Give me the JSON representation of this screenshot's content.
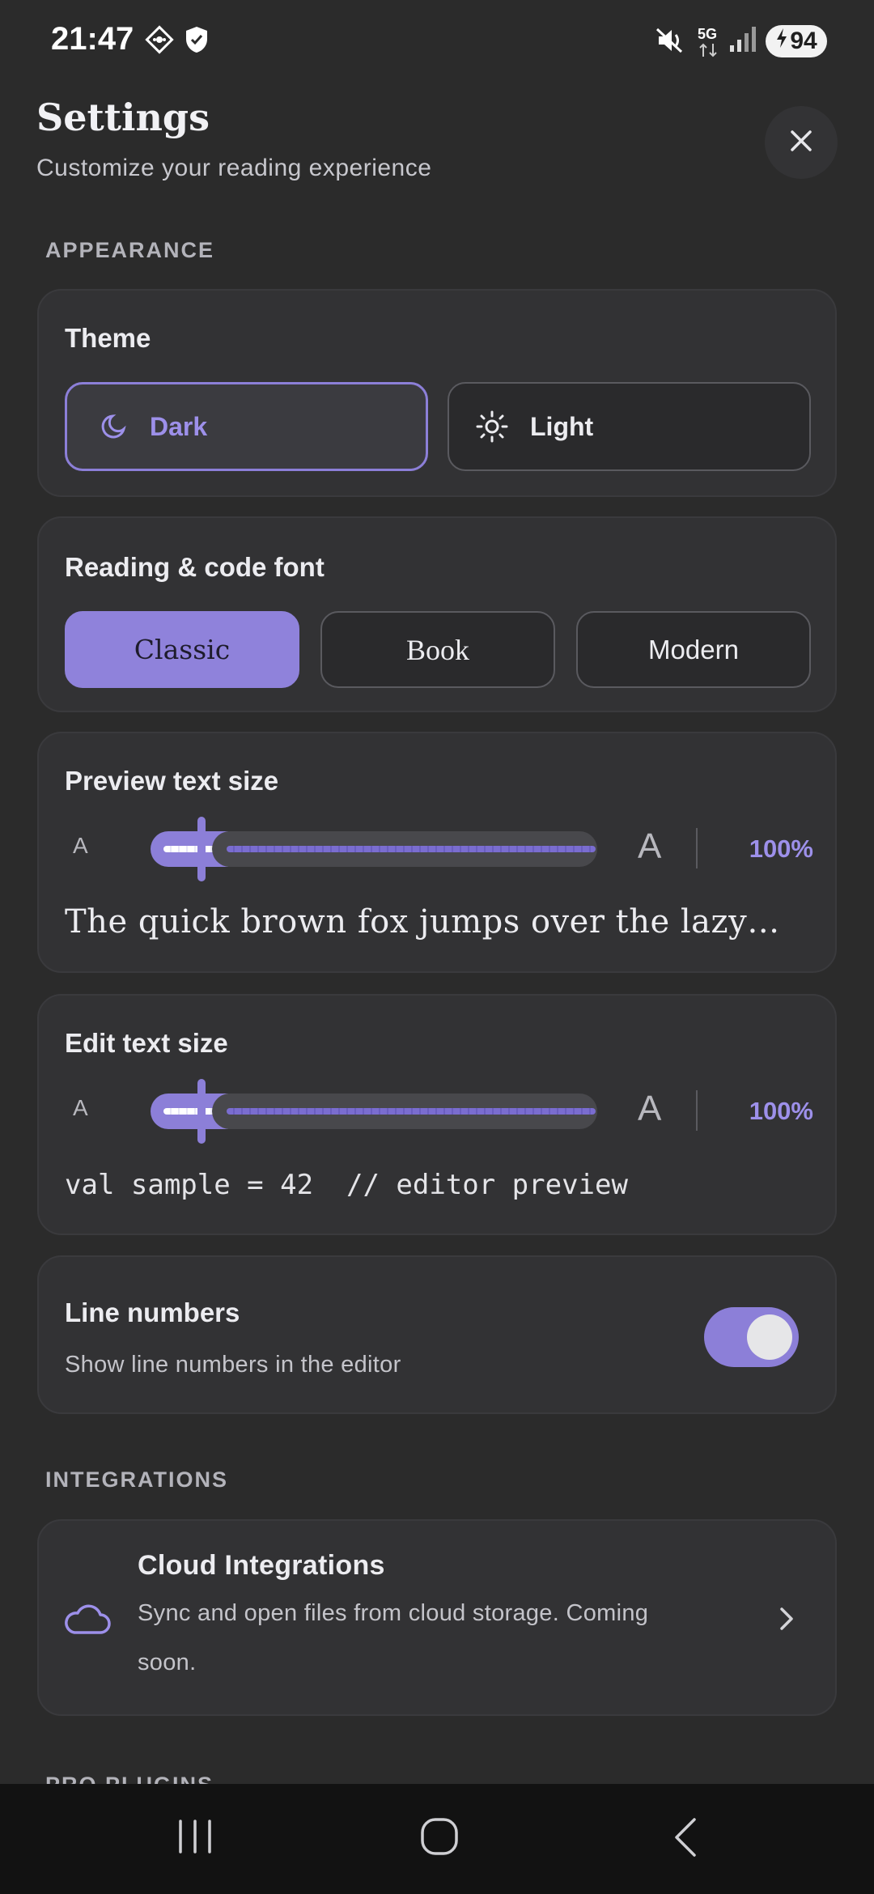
{
  "status_bar": {
    "time": "21:47",
    "network": "5G",
    "battery": "94",
    "icons": [
      "dnd-diamond-icon",
      "shield-icon",
      "mute-icon",
      "signal-icon",
      "battery-charging-icon"
    ]
  },
  "header": {
    "title": "Settings",
    "subtitle": "Customize your reading experience",
    "close_icon": "close-icon"
  },
  "appearance": {
    "label": "APPEARANCE",
    "theme": {
      "title": "Theme",
      "options": [
        {
          "label": "Dark",
          "icon": "moon-icon",
          "selected": true
        },
        {
          "label": "Light",
          "icon": "sun-icon",
          "selected": false
        }
      ]
    },
    "font": {
      "title": "Reading & code font",
      "options": [
        {
          "label": "Classic",
          "selected": true
        },
        {
          "label": "Book",
          "selected": false
        },
        {
          "label": "Modern",
          "selected": false
        }
      ]
    },
    "preview_size": {
      "title": "Preview text size",
      "small": "A",
      "large": "A",
      "value": "100%",
      "sample": "The quick brown fox jumps over the lazy…"
    },
    "edit_size": {
      "title": "Edit text size",
      "small": "A",
      "large": "A",
      "value": "100%",
      "sample": "val sample = 42  // editor preview"
    },
    "line_numbers": {
      "title": "Line numbers",
      "description": "Show line numbers in the editor",
      "enabled": true
    }
  },
  "integrations": {
    "label": "INTEGRATIONS",
    "cloud": {
      "title": "Cloud Integrations",
      "description_line1": "Sync and open files from cloud storage. Coming",
      "description_line2": "soon.",
      "icon": "cloud-icon"
    }
  },
  "next_section_label": "PRO PLUGINS",
  "colors": {
    "accent": "#8c7fd8",
    "background": "#2b2b2b",
    "card": "#323234"
  }
}
